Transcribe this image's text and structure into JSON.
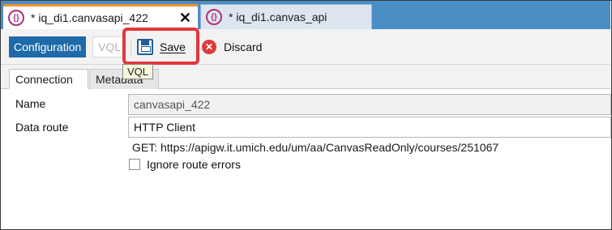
{
  "tabs": [
    {
      "title": "* iq_di1.canvasapi_422",
      "icon_text": "{}",
      "close": "✕",
      "active": true
    },
    {
      "title": "* iq_di1.canvas_api",
      "icon_text": "{}",
      "active": false
    }
  ],
  "toolbar": {
    "mode_config": "Configuration",
    "mode_vql": "VQL",
    "save_label": "Save",
    "discard_label": "Discard",
    "discard_icon": "✕"
  },
  "subtabs": {
    "connection": "Connection",
    "metadata": "Metadata",
    "tooltip": "VQL"
  },
  "form": {
    "name_label": "Name",
    "name_value": "canvasapi_422",
    "route_label": "Data route",
    "route_value": "HTTP Client",
    "route_info": "GET: https://apigw.it.umich.edu/um/aa/CanvasReadOnly/courses/251067",
    "ignore_errors_label": "Ignore route errors",
    "ignore_errors_checked": false
  },
  "colors": {
    "tabstrip": "#4a8ec6",
    "active_tab_accent": "#f0932b",
    "config_button": "#1f6aa8",
    "highlight": "#e4363d",
    "discard": "#e03a3a"
  }
}
